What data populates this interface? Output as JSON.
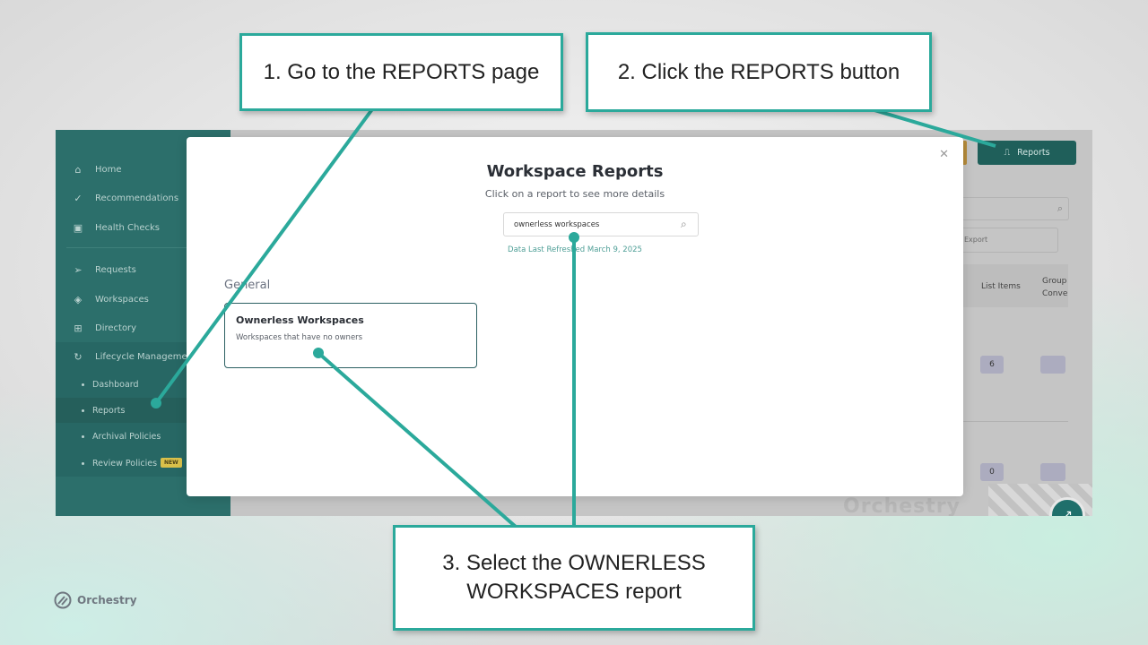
{
  "sidebar": {
    "items": [
      {
        "label": "Home",
        "icon": "home-icon",
        "glyph": "⌂"
      },
      {
        "label": "Recommendations",
        "icon": "check-circle-icon",
        "glyph": "✓"
      },
      {
        "label": "Health Checks",
        "icon": "health-check-icon",
        "glyph": "▣"
      },
      {
        "label": "Requests",
        "icon": "send-icon",
        "glyph": "➢"
      },
      {
        "label": "Workspaces",
        "icon": "layers-icon",
        "glyph": "◈"
      },
      {
        "label": "Directory",
        "icon": "hierarchy-icon",
        "glyph": "⊞"
      },
      {
        "label": "Lifecycle Management",
        "icon": "refresh-icon",
        "glyph": "↻"
      }
    ],
    "subitems": [
      {
        "label": "Dashboard"
      },
      {
        "label": "Reports"
      },
      {
        "label": "Archival Policies"
      },
      {
        "label": "Review Policies",
        "badge": "NEW"
      }
    ]
  },
  "toolbar": {
    "reports_label": "Reports",
    "export_label": "Export"
  },
  "table": {
    "col_list_items": "List Items",
    "col_group_line1": "Group",
    "col_group_line2": "Conve",
    "row1_value": "6",
    "row2_value": "0"
  },
  "background": {
    "watermark": "Orchestry"
  },
  "modal": {
    "title": "Workspace Reports",
    "subtitle": "Click on a report to see more details",
    "search_value": "ownerless workspaces",
    "refreshed": "Data Last Refreshed March 9, 2025",
    "section": "General",
    "report": {
      "title": "Ownerless Workspaces",
      "description": "Workspaces that have no owners"
    }
  },
  "callouts": {
    "step1": "1. Go to the REPORTS page",
    "step2": "2. Click the REPORTS button",
    "step3_line1": "3. Select the OWNERLESS",
    "step3_line2": "WORKSPACES report"
  },
  "brand": {
    "name": "Orchestry"
  },
  "colors": {
    "accent": "#2ba99b",
    "sidebar": "#2c6f6b",
    "link": "#4f9f97"
  }
}
